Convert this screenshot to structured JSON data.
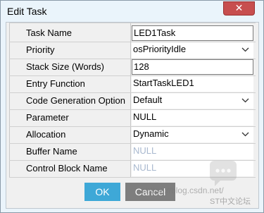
{
  "window": {
    "title": "Edit Task",
    "close_glyph": "✕"
  },
  "fields": [
    {
      "label": "Task Name",
      "value": "LED1Task",
      "kind": "text",
      "active": true
    },
    {
      "label": "Priority",
      "value": "osPriorityIdle",
      "kind": "combo"
    },
    {
      "label": "Stack Size (Words)",
      "value": "128",
      "kind": "text",
      "active": true
    },
    {
      "label": "Entry Function",
      "value": "StartTaskLED1",
      "kind": "text"
    },
    {
      "label": "Code Generation Option",
      "value": "Default",
      "kind": "combo"
    },
    {
      "label": "Parameter",
      "value": "NULL",
      "kind": "text"
    },
    {
      "label": "Allocation",
      "value": "Dynamic",
      "kind": "combo"
    },
    {
      "label": "Buffer Name",
      "value": "NULL",
      "kind": "disabled"
    },
    {
      "label": "Control Block Name",
      "value": "NULL",
      "kind": "disabled"
    }
  ],
  "buttons": {
    "ok": "OK",
    "cancel": "Cancel"
  },
  "watermark": {
    "url": "https://blog.csdn.net/",
    "brand": "ST中文论坛"
  },
  "icons": {
    "close": "close-icon",
    "dropdown": "chevron-down-icon",
    "logo": "chat-bubble-icon"
  }
}
